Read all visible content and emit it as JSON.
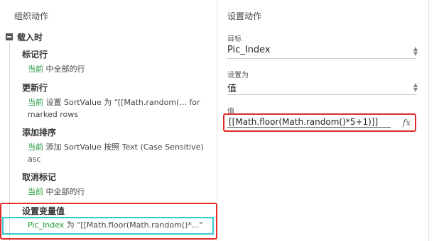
{
  "left_panel": {
    "title": "组织动作",
    "event": {
      "label": "载入时"
    },
    "actions": [
      {
        "title": "标记行",
        "desc_prefix": "当前",
        "desc_rest": " 中全部的行",
        "desc_line2": ""
      },
      {
        "title": "更新行",
        "desc_prefix": "当前",
        "desc_rest": " 设置 SortValue 为 \"[[Math.random(... for",
        "desc_line2": "marked rows"
      },
      {
        "title": "添加排序",
        "desc_prefix": "当前",
        "desc_rest": " 添加 SortValue 按照 Text (Case Sensitive)",
        "desc_line2": "asc"
      },
      {
        "title": "取消标记",
        "desc_prefix": "当前",
        "desc_rest": " 中全部的行",
        "desc_line2": ""
      },
      {
        "title": "设置变量值",
        "desc_prefix": "Pic_Index",
        "desc_rest": " 为 \"[[Math.floor(Math.random()*...\"",
        "desc_line2": ""
      }
    ]
  },
  "right_panel": {
    "title": "设置动作",
    "target": {
      "label": "目标",
      "value": "Pic_Index"
    },
    "set_to": {
      "label": "设置为",
      "value": "值"
    },
    "value": {
      "label": "值",
      "text": "[[Math.floor(Math.random()*5+1)]]",
      "fx_icon": "function-icon"
    }
  },
  "colors": {
    "green": "#1f9b3c",
    "highlight_red": "#e02a2a",
    "selection_cyan": "#38c8d2"
  }
}
